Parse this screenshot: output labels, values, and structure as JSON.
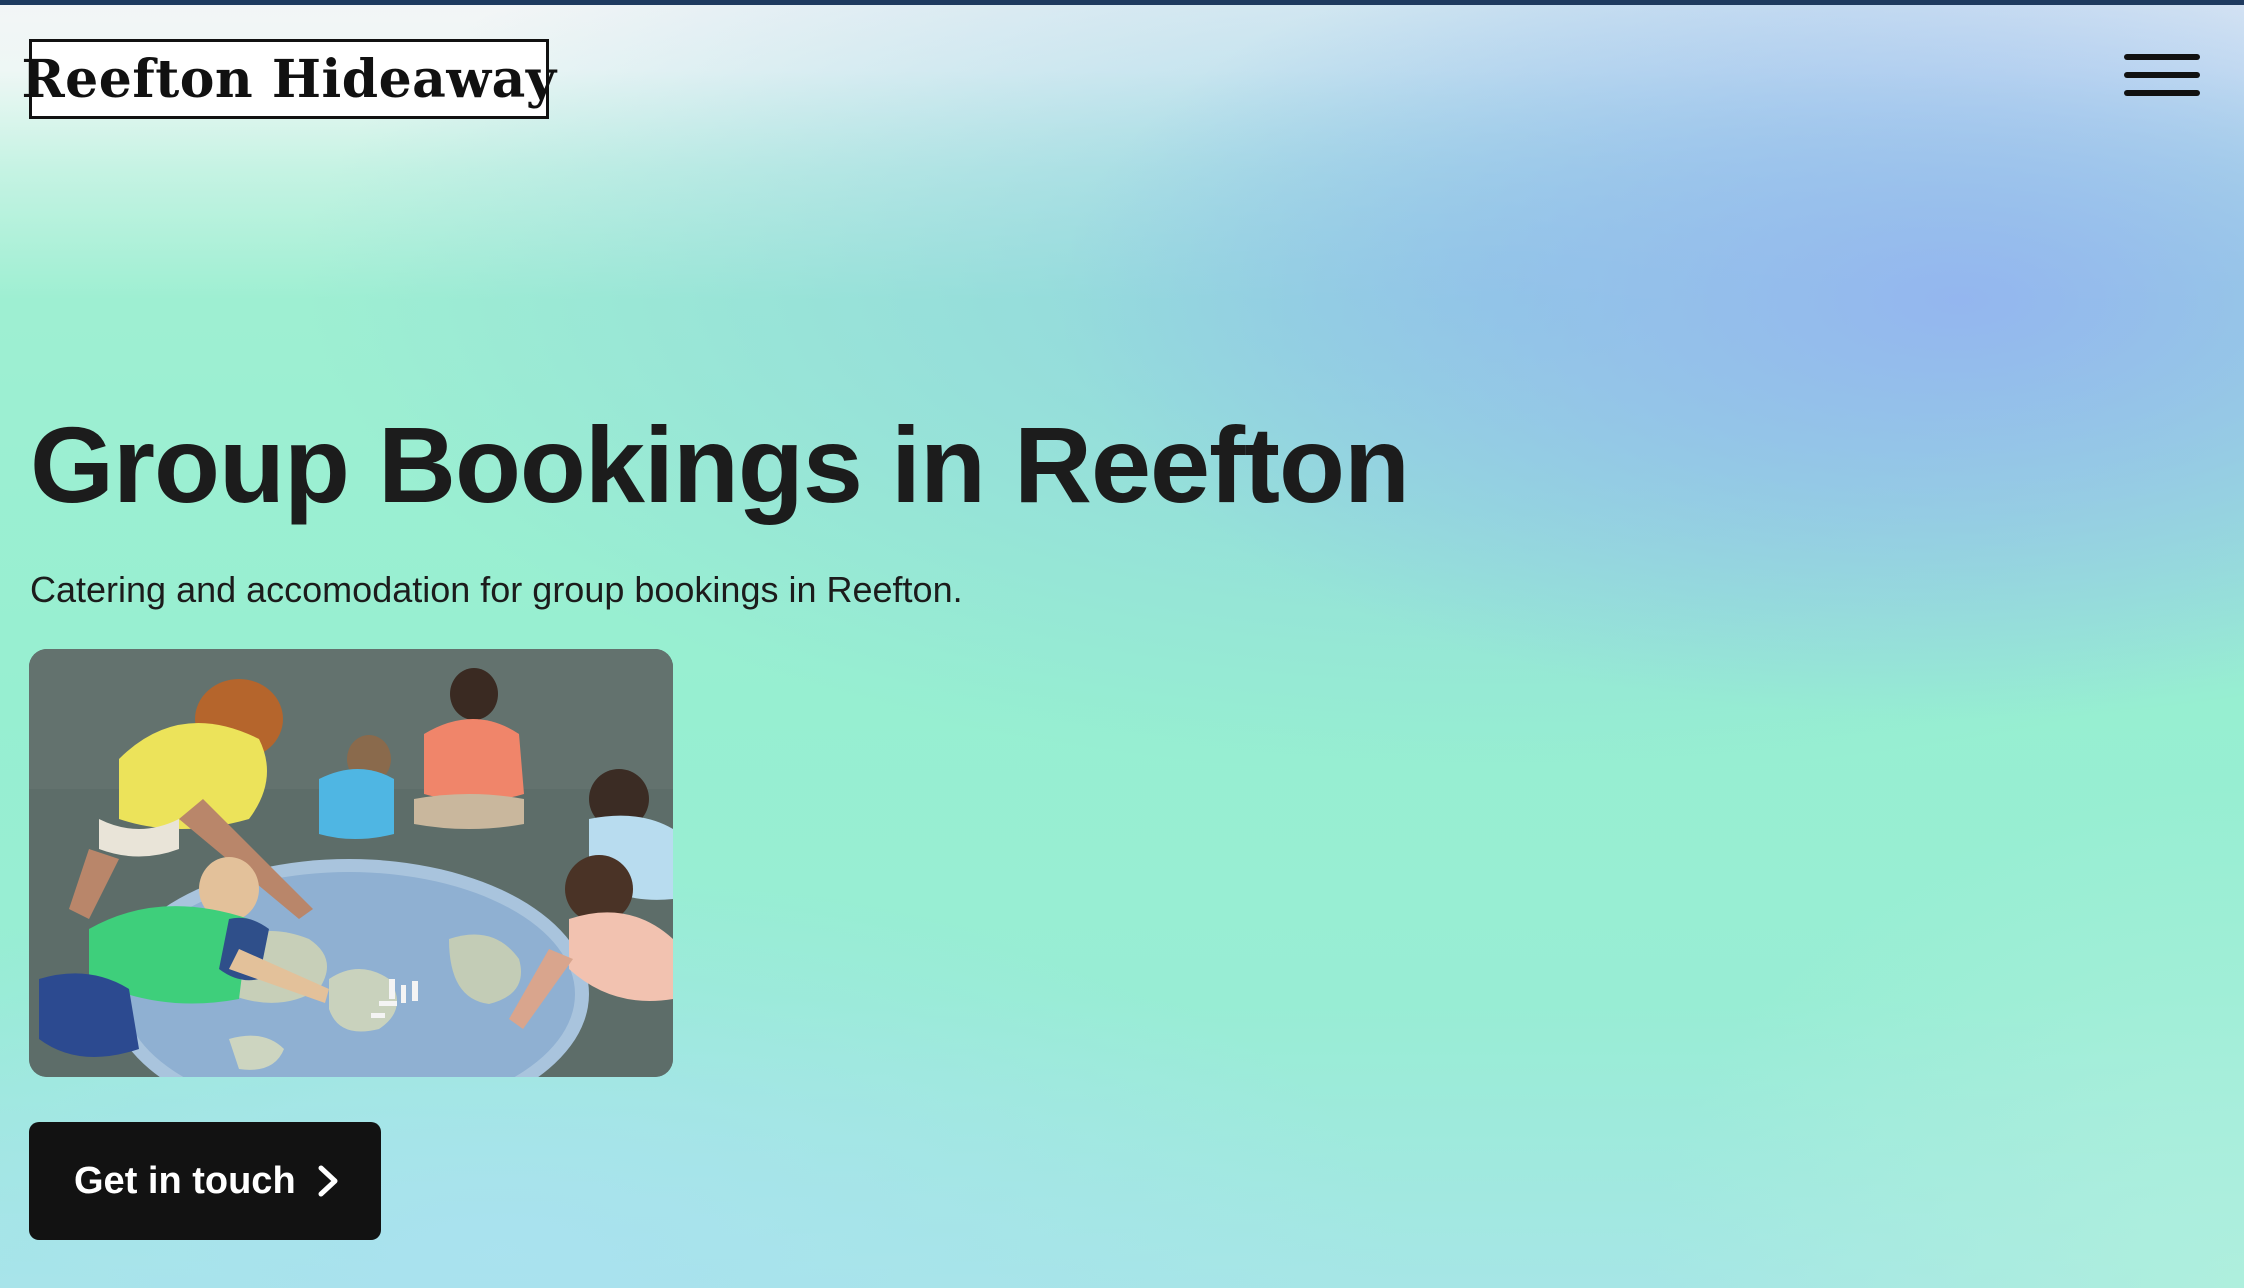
{
  "header": {
    "logo_text": "Reefton Hideaway",
    "menu_icon": "hamburger-menu-icon"
  },
  "hero": {
    "title": "Group Bookings in Reefton",
    "subtitle": "Catering and accomodation for group bookings in Reefton.",
    "cta_label": "Get in touch",
    "cta_icon": "chevron-right-icon"
  },
  "colors": {
    "top_bar": "#1e3a5f",
    "text": "#1c1c1c",
    "button_bg": "#121212",
    "button_text": "#ffffff",
    "background_mint": "#98efd2",
    "background_blue": "#94b4f0"
  }
}
